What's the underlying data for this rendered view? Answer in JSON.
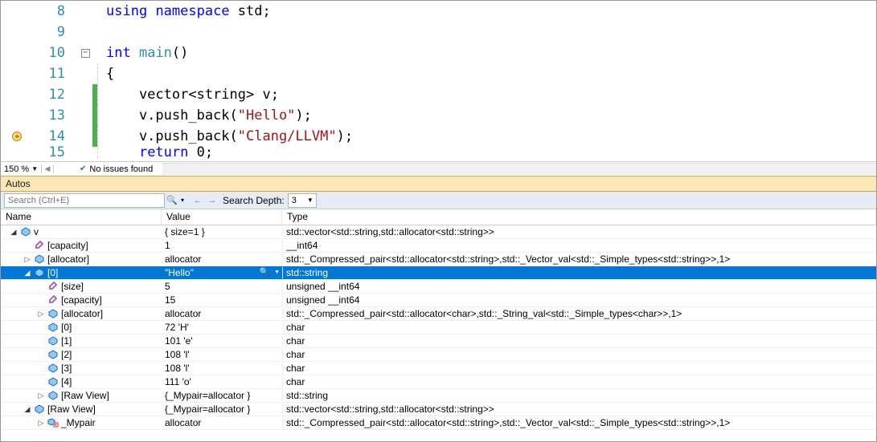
{
  "editor": {
    "lines": [
      {
        "num": "8",
        "html": "<span class='kw'>using</span> <span class='kw'>namespace</span> std;",
        "fold": "",
        "change": ""
      },
      {
        "num": "9",
        "html": "",
        "fold": "",
        "change": ""
      },
      {
        "num": "10",
        "html": "<span class='kw'>int</span> <span class='typename'>main</span>()",
        "fold": "open",
        "change": ""
      },
      {
        "num": "11",
        "html": "{",
        "fold": "line",
        "change": ""
      },
      {
        "num": "12",
        "html": "    vector&lt;string&gt; v;",
        "fold": "line",
        "change": "green"
      },
      {
        "num": "13",
        "html": "    v.push_back(<span class='str'>\"Hello\"</span>);",
        "fold": "line",
        "change": "green"
      },
      {
        "num": "14",
        "html": "    v.push_back(<span class='str'>\"Clang/LLVM\"</span>);",
        "fold": "line",
        "change": "green",
        "bp": true
      },
      {
        "num": "15",
        "html": "    <span class='kw'>return</span> 0<span class='punct'>;</span>",
        "fold": "line",
        "change": "",
        "cut": true
      }
    ]
  },
  "status": {
    "zoom": "150 %",
    "issues": "No issues found"
  },
  "autos": {
    "title": "Autos"
  },
  "search": {
    "placeholder": "Search (Ctrl+E)",
    "depth_label": "Search Depth:",
    "depth_value": "3"
  },
  "columns": {
    "name": "Name",
    "value": "Value",
    "type": "Type"
  },
  "rows": [
    {
      "depth": 0,
      "exp": "open",
      "icon": "var",
      "name": "v",
      "value": "{ size=1 }",
      "type": "std::vector<std::string,std::allocator<std::string>>"
    },
    {
      "depth": 1,
      "exp": "none",
      "icon": "prop",
      "name": "[capacity]",
      "value": "1",
      "type": "__int64"
    },
    {
      "depth": 1,
      "exp": "closed",
      "icon": "var",
      "name": "[allocator]",
      "value": "allocator",
      "type": "std::_Compressed_pair<std::allocator<std::string>,std::_Vector_val<std::_Simple_types<std::string>>,1>"
    },
    {
      "depth": 1,
      "exp": "open",
      "icon": "var",
      "name": "[0]",
      "value": "\"Hello\"",
      "type": "std::string",
      "selected": true,
      "magnify": true
    },
    {
      "depth": 2,
      "exp": "none",
      "icon": "prop",
      "name": "[size]",
      "value": "5",
      "type": "unsigned __int64"
    },
    {
      "depth": 2,
      "exp": "none",
      "icon": "prop",
      "name": "[capacity]",
      "value": "15",
      "type": "unsigned __int64"
    },
    {
      "depth": 2,
      "exp": "closed",
      "icon": "var",
      "name": "[allocator]",
      "value": "allocator",
      "type": "std::_Compressed_pair<std::allocator<char>,std::_String_val<std::_Simple_types<char>>,1>"
    },
    {
      "depth": 2,
      "exp": "none",
      "icon": "var",
      "name": "[0]",
      "value": "72 'H'",
      "type": "char"
    },
    {
      "depth": 2,
      "exp": "none",
      "icon": "var",
      "name": "[1]",
      "value": "101 'e'",
      "type": "char"
    },
    {
      "depth": 2,
      "exp": "none",
      "icon": "var",
      "name": "[2]",
      "value": "108 'l'",
      "type": "char"
    },
    {
      "depth": 2,
      "exp": "none",
      "icon": "var",
      "name": "[3]",
      "value": "108 'l'",
      "type": "char"
    },
    {
      "depth": 2,
      "exp": "none",
      "icon": "var",
      "name": "[4]",
      "value": "111 'o'",
      "type": "char"
    },
    {
      "depth": 2,
      "exp": "closed",
      "icon": "var",
      "name": "[Raw View]",
      "value": "{_Mypair=allocator }",
      "type": "std::string"
    },
    {
      "depth": 1,
      "exp": "open",
      "icon": "var",
      "name": "[Raw View]",
      "value": "{_Mypair=allocator }",
      "type": "std::vector<std::string,std::allocator<std::string>>"
    },
    {
      "depth": 2,
      "exp": "closed",
      "icon": "priv",
      "name": "_Mypair",
      "value": "allocator",
      "type": "std::_Compressed_pair<std::allocator<std::string>,std::_Vector_val<std::_Simple_types<std::string>>,1>"
    }
  ]
}
